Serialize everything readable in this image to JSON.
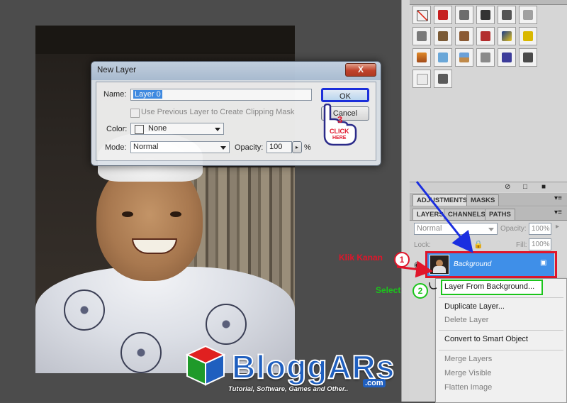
{
  "dialog": {
    "title": "New Layer",
    "close_glyph": "X",
    "name_label": "Name:",
    "name_value": "Layer 0",
    "clip_label": "Use Previous Layer to Create Clipping Mask",
    "color_label": "Color:",
    "color_value": "None",
    "mode_label": "Mode:",
    "mode_value": "Normal",
    "opacity_label": "Opacity:",
    "opacity_value": "100",
    "opacity_unit": "%",
    "ok_label": "OK",
    "cancel_label": "Cancel"
  },
  "panels": {
    "adjustments_tab": "ADJUSTMENTS",
    "masks_tab": "MASKS",
    "layers_tab": "LAYERS",
    "channels_tab": "CHANNELS",
    "paths_tab": "PATHS",
    "blend_mode": "Normal",
    "opacity_label": "Opacity:",
    "opacity_value": "100%",
    "lock_label": "Lock:",
    "fill_label": "Fill:",
    "fill_value": "100%",
    "layer_name": "Background"
  },
  "context_menu": {
    "items": [
      {
        "label": "Layer From Background...",
        "enabled": true
      },
      {
        "label": "Duplicate Layer...",
        "enabled": true
      },
      {
        "label": "Delete Layer",
        "enabled": false
      },
      {
        "label": "Convert to Smart Object",
        "enabled": true
      },
      {
        "label": "Merge Layers",
        "enabled": false
      },
      {
        "label": "Merge Visible",
        "enabled": false
      },
      {
        "label": "Flatten Image",
        "enabled": false
      }
    ]
  },
  "annotations": {
    "step1_text": "Klik Kanan",
    "step1_num": "1",
    "step2_text": "Select",
    "step2_num": "2",
    "step3_num": "3",
    "step3_click": "CLICK",
    "step3_here": "HERE"
  },
  "watermark": {
    "brand": "BloggARs",
    "tagline": "Tutorial, Software, Games and Other..",
    "domain": ".com"
  },
  "colors": {
    "accent_red": "#e0152a",
    "accent_green": "#1bc51b",
    "accent_blue": "#1a2ee0",
    "selection_blue": "#3f8fe8"
  }
}
